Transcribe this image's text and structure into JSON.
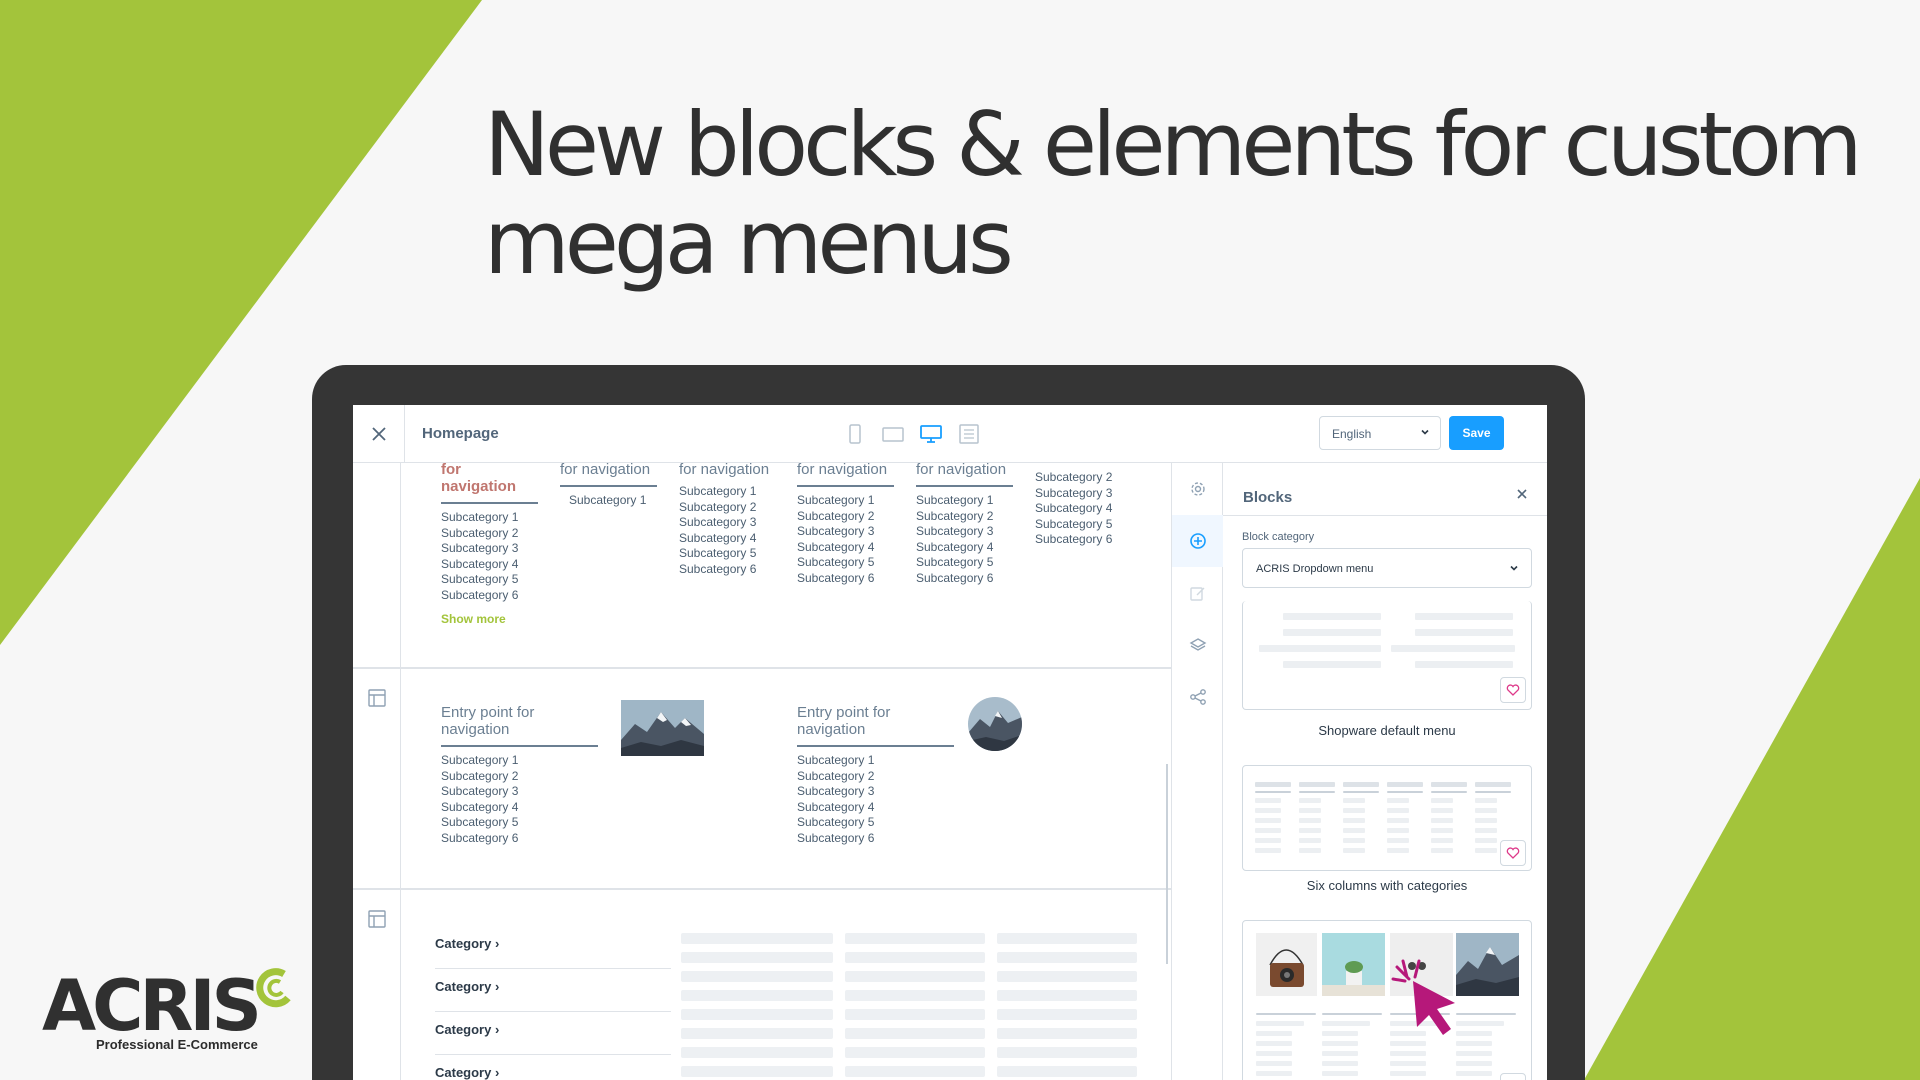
{
  "headline": {
    "line1": "New blocks & elements for custom",
    "line2": "mega menus"
  },
  "brand": {
    "logo_text": "ACRIS",
    "tagline": "Professional E-Commerce",
    "accent": "#a3c43b"
  },
  "editor": {
    "page_name": "Homepage",
    "language": "English",
    "save_label": "Save",
    "devices": [
      "mobile-icon",
      "tablet-icon",
      "desktop-icon",
      "list-icon"
    ]
  },
  "section1": {
    "columns": [
      {
        "head1": "for",
        "head2": "navigation",
        "subs": [
          "Subcategory 1",
          "Subcategory 2",
          "Subcategory 3",
          "Subcategory 4",
          "Subcategory 5",
          "Subcategory 6"
        ],
        "show_more": "Show more"
      },
      {
        "head": "for navigation",
        "subs": [
          "Subcategory 1"
        ]
      },
      {
        "head": "for navigation",
        "subs": [
          "Subcategory 1",
          "Subcategory 2",
          "Subcategory 3",
          "Subcategory 4",
          "Subcategory 5",
          "Subcategory 6"
        ]
      },
      {
        "head": "for navigation",
        "subs": [
          "Subcategory 1",
          "Subcategory 2",
          "Subcategory 3",
          "Subcategory 4",
          "Subcategory 5",
          "Subcategory 6"
        ]
      },
      {
        "head": "for navigation",
        "subs": [
          "Subcategory 1",
          "Subcategory 2",
          "Subcategory 3",
          "Subcategory 4",
          "Subcategory 5",
          "Subcategory 6"
        ]
      },
      {
        "subs": [
          "Subcategory 2",
          "Subcategory 3",
          "Subcategory 4",
          "Subcategory 5",
          "Subcategory 6"
        ]
      }
    ]
  },
  "section2": {
    "entries": [
      {
        "head1": "Entry point for",
        "head2": "navigation",
        "subs": [
          "Subcategory 1",
          "Subcategory 2",
          "Subcategory 3",
          "Subcategory 4",
          "Subcategory 5",
          "Subcategory 6"
        ]
      },
      {
        "head1": "Entry point for",
        "head2": "navigation",
        "subs": [
          "Subcategory 1",
          "Subcategory 2",
          "Subcategory 3",
          "Subcategory 4",
          "Subcategory 5",
          "Subcategory 6"
        ]
      }
    ]
  },
  "section3": {
    "categories": [
      "Category",
      "Category",
      "Category",
      "Category"
    ]
  },
  "sidebar": {
    "icons": [
      "gear-icon",
      "plus-circle-icon",
      "edit-icon",
      "layers-icon",
      "share-icon"
    ],
    "panel_title": "Blocks",
    "block_category_label": "Block category",
    "block_category_value": "ACRIS Dropdown menu",
    "cards": [
      {
        "label": "Shopware default menu"
      },
      {
        "label": "Six columns with categories"
      },
      {
        "label": ""
      }
    ]
  }
}
